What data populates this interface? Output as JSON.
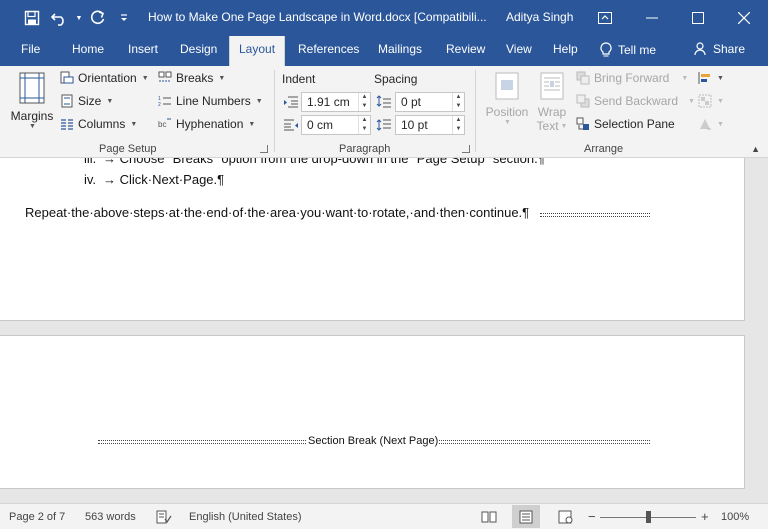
{
  "title_bar": {
    "doc_title": "How to Make One Page Landscape in Word.docx [Compatibili...",
    "user": "Aditya Singh",
    "qat_icons": [
      "save-icon",
      "undo-icon",
      "redo-icon",
      "customize-qat-icon"
    ],
    "window_icons": [
      "ribbon-display-icon",
      "minimize-icon",
      "maximize-icon",
      "close-icon"
    ]
  },
  "tabs": {
    "items": [
      "File",
      "Home",
      "Insert",
      "Design",
      "Layout",
      "References",
      "Mailings",
      "Review",
      "View",
      "Help"
    ],
    "active": "Layout",
    "tell_me": "Tell me",
    "share": "Share"
  },
  "ribbon": {
    "page_setup": {
      "margins": "Margins",
      "orientation": "Orientation",
      "size": "Size",
      "columns": "Columns",
      "breaks": "Breaks",
      "line_numbers": "Line Numbers",
      "hyphenation": "Hyphenation",
      "label": "Page Setup"
    },
    "paragraph": {
      "indent_label": "Indent",
      "spacing_label": "Spacing",
      "indent_left": "1.91 cm",
      "indent_right": "0 cm",
      "spacing_before": "0 pt",
      "spacing_after": "10 pt",
      "label": "Paragraph"
    },
    "arrange": {
      "position": "Position",
      "wrap_text_1": "Wrap",
      "wrap_text_2": "Text",
      "bring_forward": "Bring Forward",
      "send_backward": "Send Backward",
      "selection_pane": "Selection Pane",
      "label": "Arrange"
    }
  },
  "document": {
    "list_item_3_num": "iii.",
    "list_item_3": "→  Choose \"Breaks\" option from the drop-down in the \"Page Setup\" section.¶",
    "list_item_4_num": "iv.",
    "list_item_4": "→  Click·Next·Page.¶",
    "paragraph": "Repeat·the·above·steps·at·the·end·of·the·area·you·want·to·rotate,·and·then·continue.¶",
    "section_break": "Section Break (Next Page)"
  },
  "status_bar": {
    "page": "Page 2 of 7",
    "words": "563 words",
    "language": "English (United States)",
    "zoom": "100%",
    "zoom_minus": "−",
    "zoom_plus": "+"
  },
  "colors": {
    "accent": "#2b579a",
    "ribbon_bg": "#f3f3f3",
    "workspace": "#e6e6e6"
  }
}
